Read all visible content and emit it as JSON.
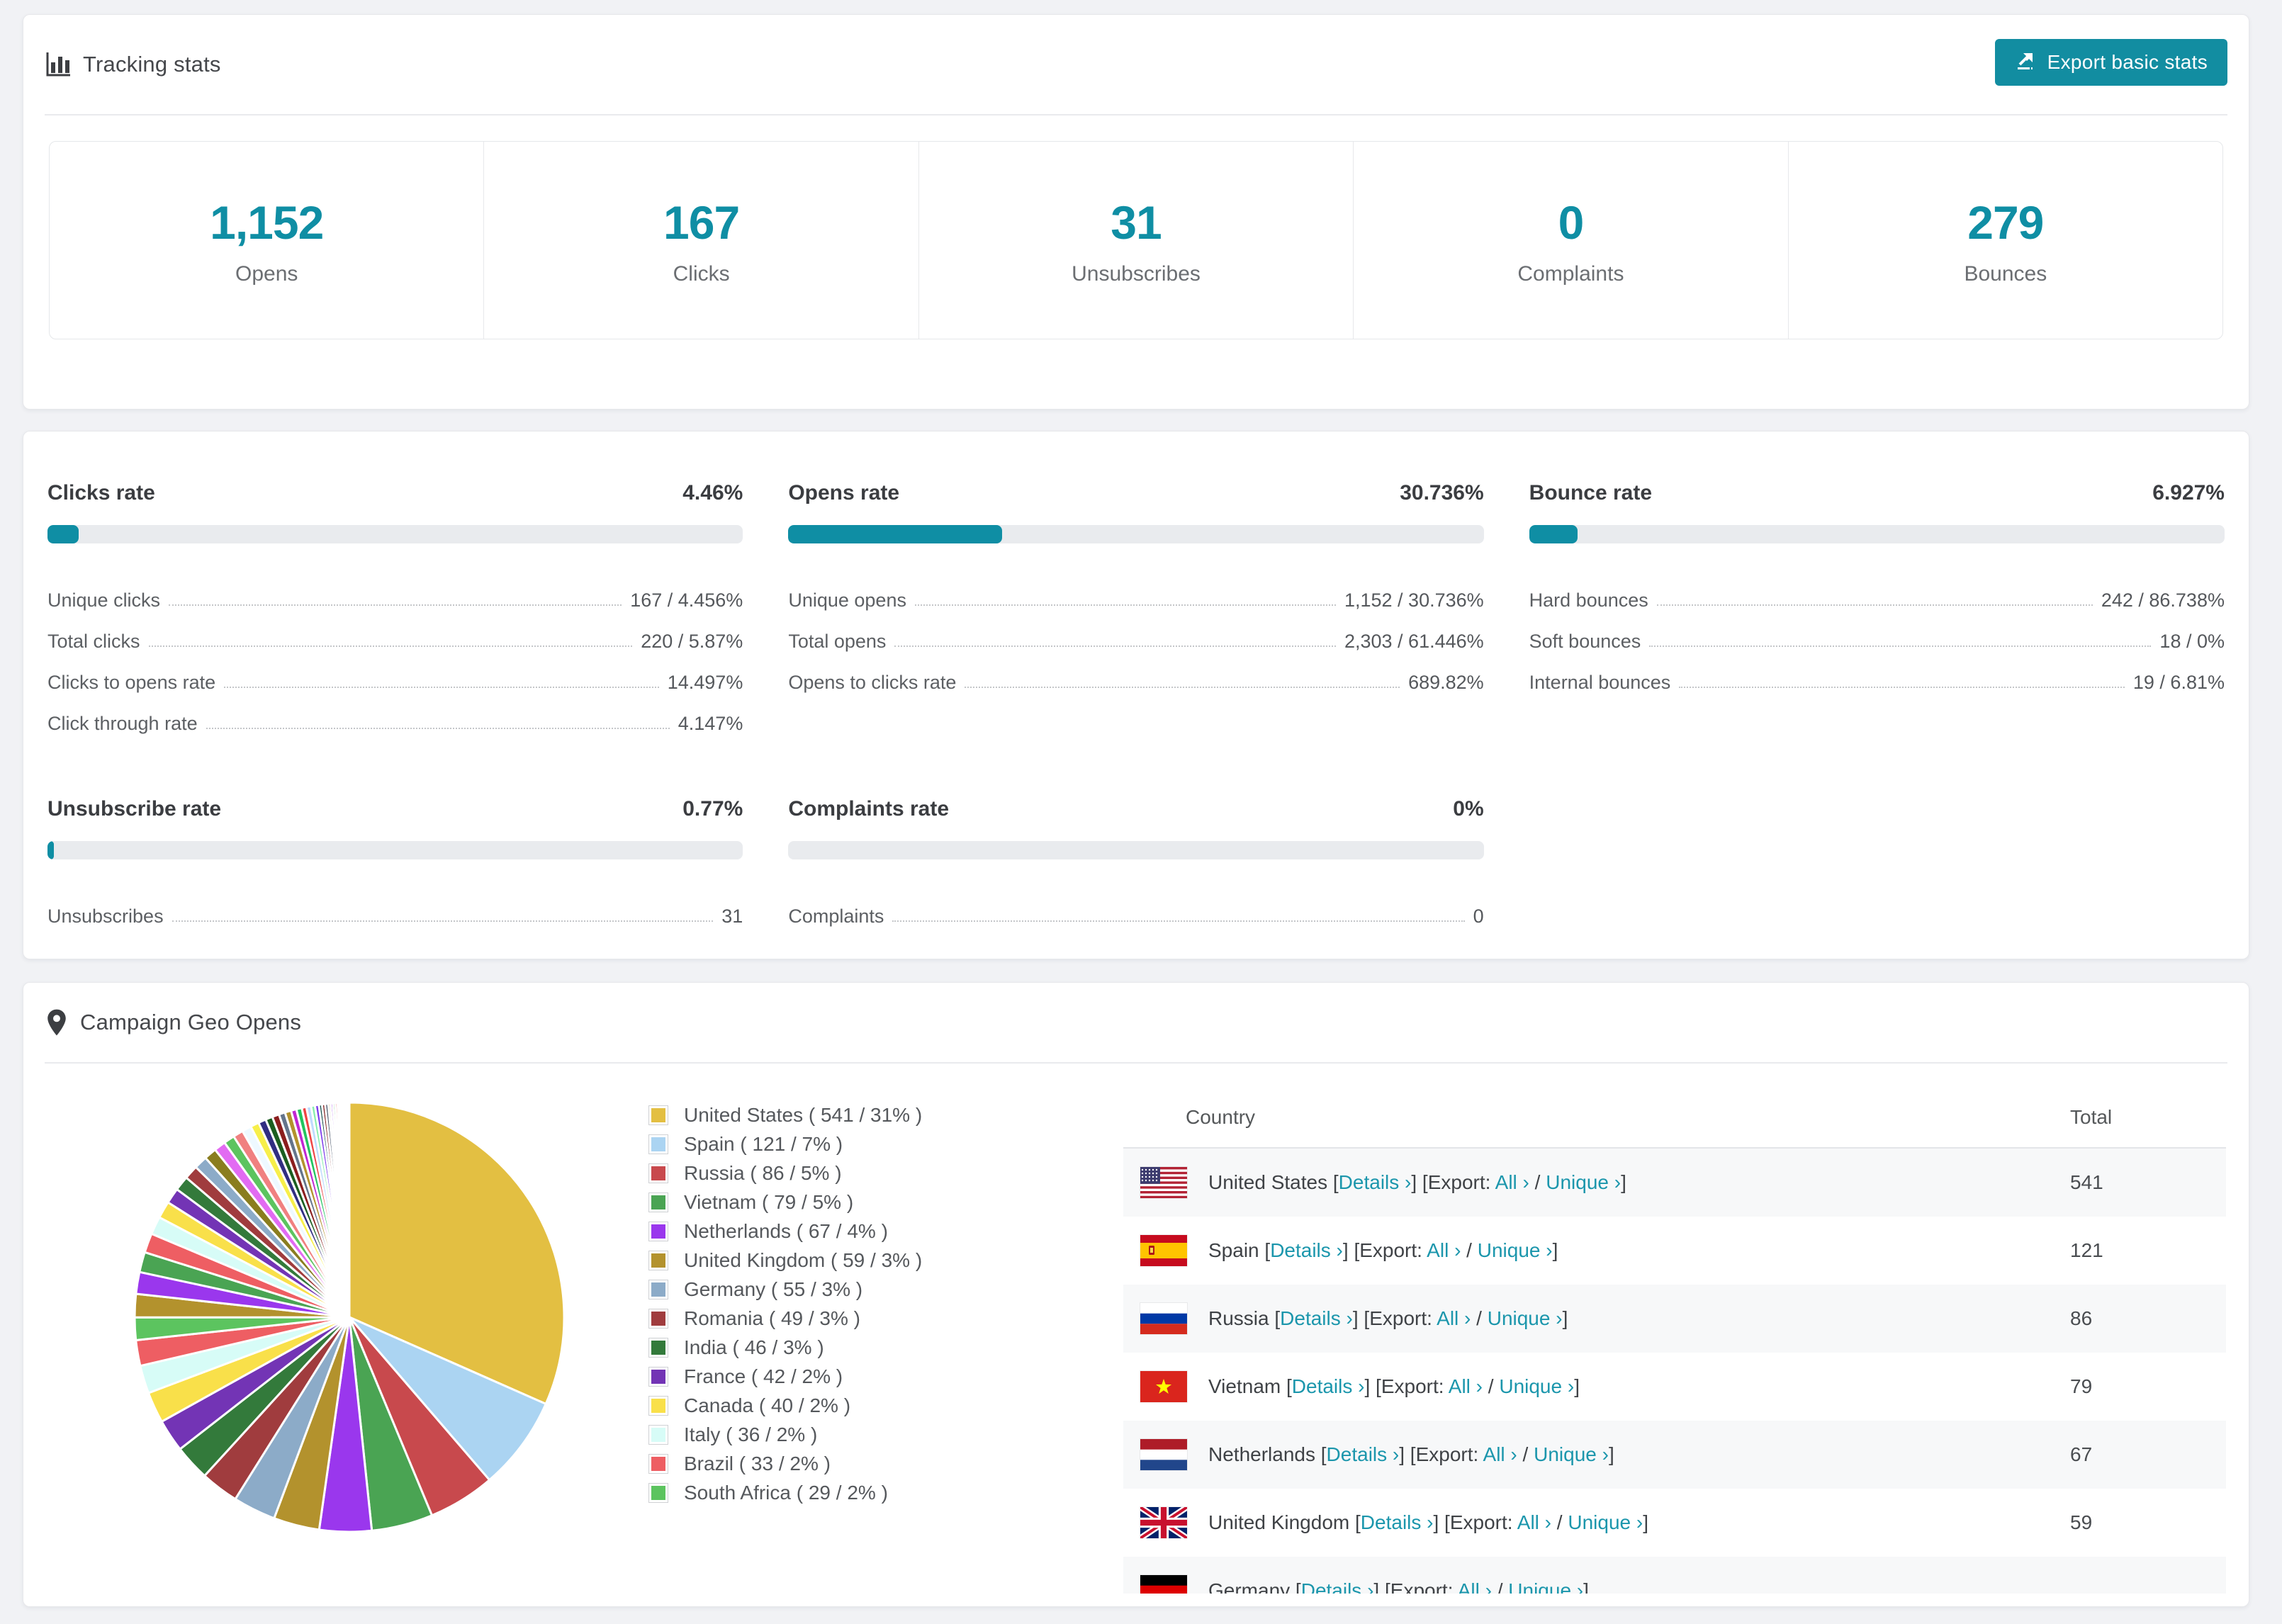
{
  "header": {
    "title": "Tracking stats",
    "export_button": "Export basic stats"
  },
  "summary": {
    "items": [
      {
        "value": "1,152",
        "label": "Opens"
      },
      {
        "value": "167",
        "label": "Clicks"
      },
      {
        "value": "31",
        "label": "Unsubscribes"
      },
      {
        "value": "0",
        "label": "Complaints"
      },
      {
        "value": "279",
        "label": "Bounces"
      }
    ]
  },
  "rates": {
    "panels": [
      {
        "title": "Clicks rate",
        "value": "4.46%",
        "bar_pct": 4.46,
        "rows": [
          [
            "Unique clicks",
            "167 / 4.456%"
          ],
          [
            "Total clicks",
            "220 / 5.87%"
          ],
          [
            "Clicks to opens rate",
            "14.497%"
          ],
          [
            "Click through rate",
            "4.147%"
          ]
        ]
      },
      {
        "title": "Opens rate",
        "value": "30.736%",
        "bar_pct": 30.736,
        "rows": [
          [
            "Unique opens",
            "1,152 / 30.736%"
          ],
          [
            "Total opens",
            "2,303 / 61.446%"
          ],
          [
            "Opens to clicks rate",
            "689.82%"
          ]
        ]
      },
      {
        "title": "Bounce rate",
        "value": "6.927%",
        "bar_pct": 6.927,
        "rows": [
          [
            "Hard bounces",
            "242 / 86.738%"
          ],
          [
            "Soft bounces",
            "18 / 0%"
          ],
          [
            "Internal bounces",
            "19 / 6.81%"
          ]
        ]
      },
      {
        "title": "Unsubscribe rate",
        "value": "0.77%",
        "bar_pct": 0.77,
        "rows": [
          [
            "Unsubscribes",
            "31"
          ]
        ]
      },
      {
        "title": "Complaints rate",
        "value": "0%",
        "bar_pct": 0,
        "rows": [
          [
            "Complaints",
            "0"
          ]
        ]
      }
    ]
  },
  "geo": {
    "title": "Campaign Geo Opens",
    "table": {
      "columns": [
        "Country",
        "Total"
      ],
      "link_labels": {
        "details": "Details ›",
        "export": "Export:",
        "all": "All ›",
        "unique": "Unique ›"
      },
      "rows": [
        {
          "country": "United States",
          "flag": "us",
          "total": "541"
        },
        {
          "country": "Spain",
          "flag": "es",
          "total": "121"
        },
        {
          "country": "Russia",
          "flag": "ru",
          "total": "86"
        },
        {
          "country": "Vietnam",
          "flag": "vn",
          "total": "79"
        },
        {
          "country": "Netherlands",
          "flag": "nl",
          "total": "67"
        },
        {
          "country": "United Kingdom",
          "flag": "gb",
          "total": "59"
        },
        {
          "country": "Germany",
          "flag": "de",
          "total": "",
          "partial": true
        }
      ]
    }
  },
  "chart_data": {
    "type": "pie",
    "title": "Campaign Geo Opens",
    "unit": "opens",
    "legend_position": "right",
    "legend_format": "{label} ( {value} / {pct}% )",
    "slices": [
      {
        "label": "United States",
        "value": 541,
        "pct": 31,
        "color": "#e3bf42"
      },
      {
        "label": "Spain",
        "value": 121,
        "pct": 7,
        "color": "#abd4f2"
      },
      {
        "label": "Russia",
        "value": 86,
        "pct": 5,
        "color": "#c8494d"
      },
      {
        "label": "Vietnam",
        "value": 79,
        "pct": 5,
        "color": "#4aa453"
      },
      {
        "label": "Netherlands",
        "value": 67,
        "pct": 4,
        "color": "#9a37ed"
      },
      {
        "label": "United Kingdom",
        "value": 59,
        "pct": 3,
        "color": "#b3922d"
      },
      {
        "label": "Germany",
        "value": 55,
        "pct": 3,
        "color": "#8cabc8"
      },
      {
        "label": "Romania",
        "value": 49,
        "pct": 3,
        "color": "#a03c3e"
      },
      {
        "label": "India",
        "value": 46,
        "pct": 3,
        "color": "#337a3b"
      },
      {
        "label": "France",
        "value": 42,
        "pct": 2,
        "color": "#7334b5"
      },
      {
        "label": "Canada",
        "value": 40,
        "pct": 2,
        "color": "#f9e04a"
      },
      {
        "label": "Italy",
        "value": 36,
        "pct": 2,
        "color": "#d7fcf7"
      },
      {
        "label": "Brazil",
        "value": 33,
        "pct": 2,
        "color": "#ee5e63"
      },
      {
        "label": "South Africa",
        "value": 29,
        "pct": 2,
        "color": "#5cc45f"
      }
    ],
    "others_unlabeled": {
      "values": [
        30,
        28,
        26,
        25,
        23,
        22,
        20,
        19,
        18,
        17,
        16,
        15,
        14,
        13,
        12,
        11,
        10,
        9,
        9,
        8,
        8,
        7,
        7,
        6,
        6,
        5,
        5,
        4,
        4,
        4,
        3,
        3,
        3,
        3,
        2,
        2,
        2,
        2,
        2,
        1,
        1,
        1,
        1,
        1
      ],
      "colors": [
        "#b3922d",
        "#9a37ed",
        "#4aa453",
        "#ee5e63",
        "#d7fcf7",
        "#f9e04a",
        "#7334b5",
        "#337a3b",
        "#a03c3e",
        "#8cabc8",
        "#8a7d1f",
        "#e26bf2",
        "#5cc45f",
        "#f08080",
        "#eef9ff",
        "#f7ef4a",
        "#312e81",
        "#1b5e20",
        "#8b1e1e",
        "#64748b",
        "#b3922d",
        "#c026d3",
        "#22c55e",
        "#ef4444",
        "#bfdbfe",
        "#86efac",
        "#7c3aed",
        "#134e4a",
        "#7f1d1d",
        "#475569"
      ]
    }
  },
  "colors": {
    "accent": "#0f8ea4",
    "link": "#1b96ac",
    "page_bg": "#f1f2f5"
  }
}
